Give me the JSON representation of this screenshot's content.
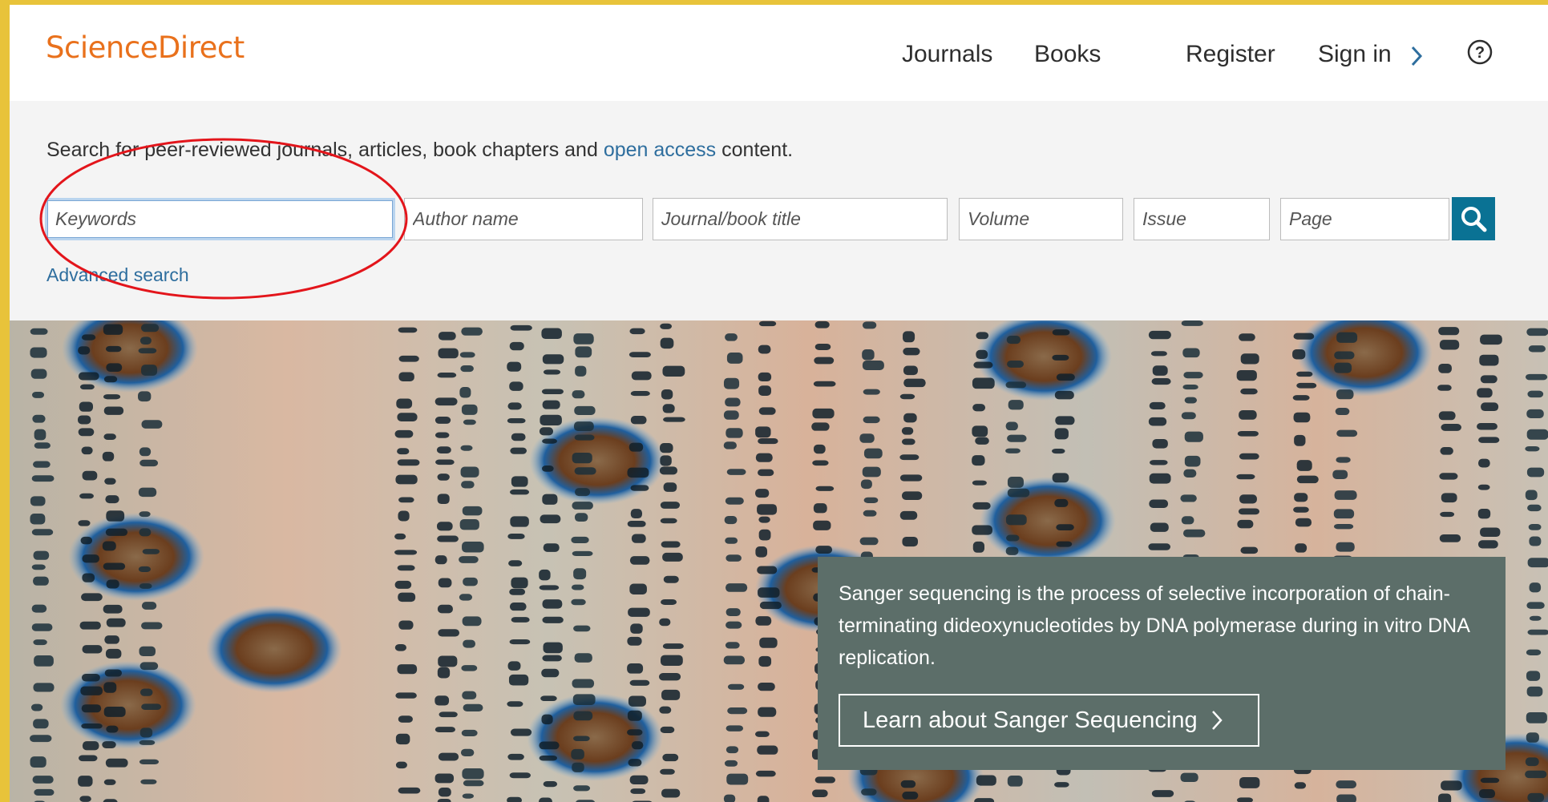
{
  "colors": {
    "frame_border": "#e8c33a",
    "brand_orange": "#e9711c",
    "link_blue": "#2e6e9e",
    "search_button": "#0a7294",
    "annotation_red": "#e3151b",
    "info_box": "#5c6e69"
  },
  "header": {
    "logo": "ScienceDirect",
    "nav": {
      "journals": "Journals",
      "books": "Books",
      "register": "Register",
      "sign_in": "Sign in"
    },
    "icons": {
      "sign_in_chevron": "chevron-right-icon",
      "help": "help-circle-icon"
    }
  },
  "search": {
    "intro_before": "Search for peer-reviewed journals, articles, book chapters and ",
    "intro_link": "open access",
    "intro_after": " content.",
    "fields": {
      "keywords": {
        "placeholder": "Keywords",
        "value": ""
      },
      "author": {
        "placeholder": "Author name",
        "value": ""
      },
      "journal": {
        "placeholder": "Journal/book title",
        "value": ""
      },
      "volume": {
        "placeholder": "Volume",
        "value": ""
      },
      "issue": {
        "placeholder": "Issue",
        "value": ""
      },
      "page": {
        "placeholder": "Page",
        "value": ""
      }
    },
    "button_icon": "search-icon",
    "advanced_link": "Advanced search"
  },
  "hero": {
    "description": "Sanger sequencing is the process of selective incorporation of chain-terminating dideoxynucleotides by DNA polymerase during in vitro DNA replication.",
    "cta_label": "Learn about Sanger Sequencing",
    "cta_icon": "chevron-right-icon"
  }
}
